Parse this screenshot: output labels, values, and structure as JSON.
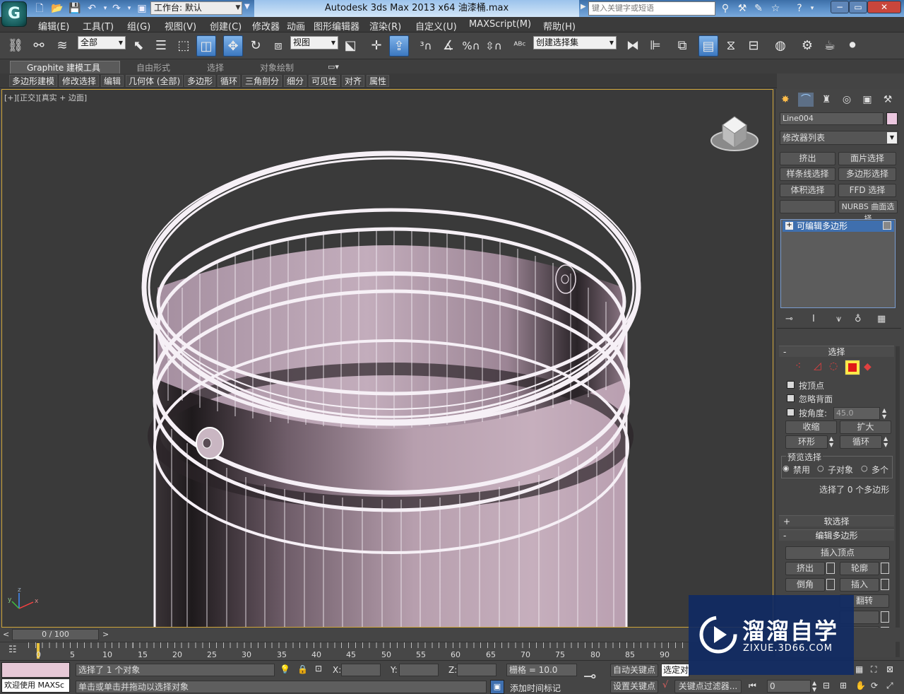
{
  "titlebar": {
    "workspace": "工作台: 默认",
    "app_title": "Autodesk 3ds Max  2013 x64      油漆桶.max",
    "search_placeholder": "键入关键字或短语"
  },
  "menu": [
    "编辑(E)",
    "工具(T)",
    "组(G)",
    "视图(V)",
    "创建(C)",
    "修改器",
    "动画",
    "图形编辑器",
    "渲染(R)",
    "自定义(U)",
    "MAXScript(M)",
    "帮助(H)"
  ],
  "toolbar": {
    "filter": "全部",
    "refcoord": "视图",
    "named_selection": "创建选择集"
  },
  "ribbon": {
    "tabs": [
      "Graphite 建模工具",
      "自由形式",
      "选择",
      "对象绘制"
    ],
    "panels": [
      "多边形建模",
      "修改选择",
      "编辑",
      "几何体 (全部)",
      "多边形",
      "循环",
      "三角剖分",
      "细分",
      "可见性",
      "对齐",
      "属性"
    ]
  },
  "viewport": {
    "label_prefix": "[+][",
    "view_name": "正交",
    "label_mid": "][",
    "shading": "真实 + 边面",
    "label_suffix": "]"
  },
  "command_panel": {
    "object_name": "Line004",
    "modifier_list": "修改器列表",
    "mod_buttons": [
      "挤出",
      "面片选择",
      "样条线选择",
      "多边形选择",
      "体积选择",
      "FFD 选择",
      "",
      "NURBS 曲面选择"
    ],
    "stack_item": "可编辑多边形",
    "rollout_select": "选择",
    "by_vertex": "按顶点",
    "ignore_backfacing": "忽略背面",
    "by_angle": "按角度:",
    "angle_value": "45.0",
    "shrink": "收缩",
    "grow": "扩大",
    "ring": "环形",
    "loop": "循环",
    "preview_select": "预览选择",
    "disabled": "禁用",
    "subobject": "子对象",
    "multiple": "多个",
    "selection_status": "选择了 0 个多边形",
    "soft_selection": "软选择",
    "edit_polygons": "编辑多边形",
    "insert_vertex": "插入顶点",
    "extrude": "挤出",
    "outline": "轮廓",
    "bevel": "倒角",
    "inset": "插入",
    "flip": "翻转"
  },
  "timeline": {
    "slider": "0 / 100",
    "ticks": [
      "0",
      "5",
      "10",
      "15",
      "20",
      "25",
      "30",
      "35",
      "40",
      "45",
      "50",
      "55",
      "60",
      "65",
      "70",
      "75",
      "80",
      "85",
      "90"
    ]
  },
  "status": {
    "welcome": "欢迎使用 MAXSc",
    "selected": "选择了 1 个对象",
    "prompt": "单击或单击并拖动以选择对象",
    "x_label": "X:",
    "y_label": "Y:",
    "z_label": "Z:",
    "grid": "栅格 = 10.0",
    "add_time_tag": "添加时间标记",
    "auto_key": "自动关键点",
    "selected_obj": "选定对",
    "set_key": "设置关键点",
    "key_filters": "关键点过滤器...",
    "frame": "0"
  },
  "watermark": {
    "name": "溜溜自学",
    "url": "ZIXUE.3D66.COM"
  },
  "colors": {
    "accent": "#4a7fc0",
    "object_color": "#ebc7df",
    "viewport_border": "#cfa53a"
  }
}
